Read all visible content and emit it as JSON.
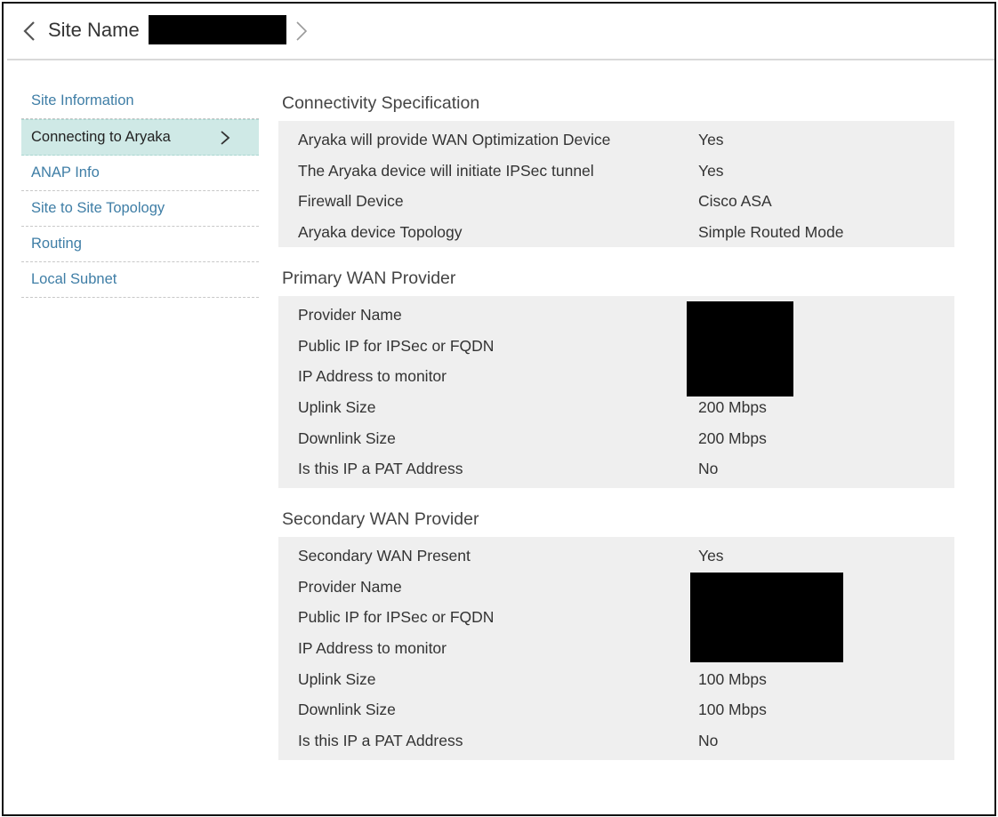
{
  "header": {
    "title": "Site Name",
    "icons": {
      "back": "chevron-left-icon",
      "forward": "chevron-right-icon"
    }
  },
  "sidebar": {
    "items": [
      {
        "label": "Site Information",
        "active": false
      },
      {
        "label": "Connecting to Aryaka",
        "active": true
      },
      {
        "label": "ANAP Info",
        "active": false
      },
      {
        "label": "Site to Site Topology",
        "active": false
      },
      {
        "label": "Routing",
        "active": false
      },
      {
        "label": "Local Subnet",
        "active": false
      }
    ]
  },
  "sections": {
    "connectivity": {
      "title": "Connectivity Specification",
      "rows": [
        {
          "label": "Aryaka will provide WAN Optimization Device",
          "value": "Yes"
        },
        {
          "label": "The Aryaka device will initiate IPSec tunnel",
          "value": "Yes"
        },
        {
          "label": "Firewall Device",
          "value": "Cisco ASA"
        },
        {
          "label": "Aryaka device Topology",
          "value": "Simple Routed Mode"
        }
      ]
    },
    "primary_wan": {
      "title": "Primary WAN Provider",
      "rows": [
        {
          "label": "Provider Name",
          "value": ""
        },
        {
          "label": "Public IP for IPSec or FQDN",
          "value": ""
        },
        {
          "label": "IP Address to monitor",
          "value": ""
        },
        {
          "label": "Uplink Size",
          "value": "200 Mbps"
        },
        {
          "label": "Downlink Size",
          "value": "200 Mbps"
        },
        {
          "label": "Is this IP a PAT Address",
          "value": "No"
        }
      ]
    },
    "secondary_wan": {
      "title": "Secondary WAN Provider",
      "rows": [
        {
          "label": "Secondary WAN Present",
          "value": "Yes"
        },
        {
          "label": "Provider Name",
          "value": ""
        },
        {
          "label": "Public IP for IPSec or FQDN",
          "value": ""
        },
        {
          "label": "IP Address to monitor",
          "value": ""
        },
        {
          "label": "Uplink Size",
          "value": "100 Mbps"
        },
        {
          "label": "Downlink Size",
          "value": "100 Mbps"
        },
        {
          "label": "Is this IP a PAT Address",
          "value": "No"
        }
      ]
    }
  },
  "colors": {
    "link": "#3f7ea6",
    "active_bg": "#cfe9e6",
    "panel_bg": "#efefef",
    "redaction": "#000000"
  }
}
